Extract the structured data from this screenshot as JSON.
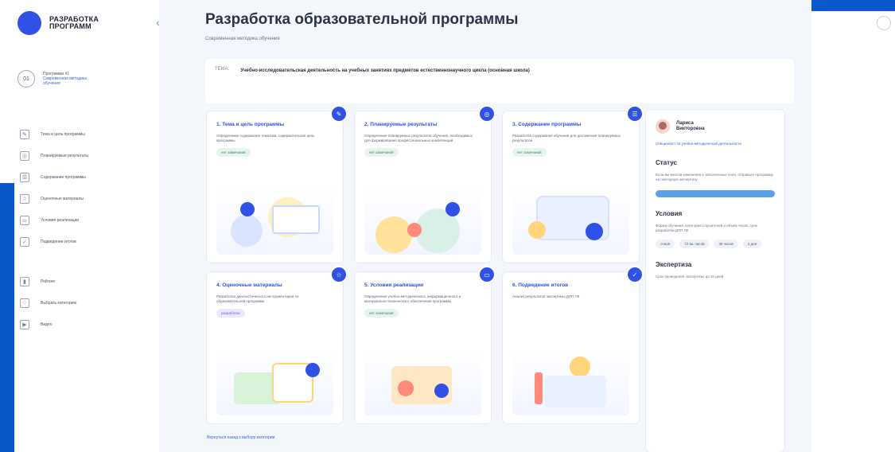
{
  "sidebar": {
    "logo_text_line1": "РАЗРАБОТКА",
    "logo_text_line2": "ПРОГРАММ",
    "user_id": "01",
    "user_line1": "Программа #1",
    "user_line2": "Современная методика",
    "user_line3": "обучения",
    "nav": [
      {
        "label": "Тема и цель программы",
        "icon": "edit-icon"
      },
      {
        "label": "Планируемые результаты",
        "icon": "target-icon"
      },
      {
        "label": "Содержание программы",
        "icon": "list-icon"
      },
      {
        "label": "Оценочные материалы",
        "icon": "star-icon"
      },
      {
        "label": "Условия реализации",
        "icon": "book-icon"
      },
      {
        "label": "Подведение итогов",
        "icon": "check-icon"
      }
    ],
    "nav2": [
      {
        "label": "Рейтинг",
        "icon": "bar-chart-icon"
      },
      {
        "label": "Выбрать категорию",
        "icon": "circle-icon"
      },
      {
        "label": "Видео",
        "icon": "play-icon"
      }
    ]
  },
  "main": {
    "title": "Разработка образовательной программы",
    "subtitle": "Современная методика обучения",
    "theme_key": "ТЕМА:",
    "theme_value": "Учебно-исследовательская деятельность на учебных занятиях предметов естественнонаучного цикла (основная школа)",
    "cards": [
      {
        "title": "1. Тема и цель программы",
        "desc": "Определение содержания тематики, содержательная цель программы",
        "pill": "нет замечаний",
        "pill_style": "green",
        "badge_icon": "edit-icon"
      },
      {
        "title": "2. Планируемые результаты",
        "desc": "Определение планируемых результатов обучения, необходимых для формирования профессиональных компетенций",
        "pill": "нет замечаний",
        "pill_style": "green",
        "badge_icon": "target-icon"
      },
      {
        "title": "3. Содержание программы",
        "desc": "Разработка содержания обучения для достижения планируемых результатов",
        "pill": "нет замечаний",
        "pill_style": "green",
        "badge_icon": "list-icon"
      },
      {
        "title": "4. Оценочные материалы",
        "desc": "Разработка диагностического инструментария по образовательной программе",
        "pill": "разработка",
        "pill_style": "purple",
        "badge_icon": "star-icon"
      },
      {
        "title": "5. Условия реализации",
        "desc": "Определение учебно-методического, информационного и материально-технического обеспечения программы",
        "pill": "нет замечаний",
        "pill_style": "green",
        "badge_icon": "book-icon"
      },
      {
        "title": "6. Подведение итогов",
        "desc": "Анализ результатов экспертизы ДПП ПК",
        "pill": "",
        "pill_style": "none",
        "badge_icon": "check-icon"
      }
    ],
    "bottom_link": "Вернуться назад к выбору категории"
  },
  "right": {
    "person_name_line1": "Лариса",
    "person_name_line2": "Викторовна",
    "person_link": "Специалист по учебно-методической деятельности",
    "status_title": "Статус",
    "status_text": "Если вы внесли изменения в заполненные поля, отправьте программу на повторную экспертизу",
    "conditions_title": "Условия",
    "conditions_text": "Форма обучения, категория слушателей и объём часов, срок разработки ДПП ПК",
    "chips": [
      "очная",
      "72 ак. часов",
      "36 часов",
      "3 дня"
    ],
    "expertise_title": "Экспертиза",
    "expertise_text": "Срок проведения экспертизы до 10 дней"
  }
}
